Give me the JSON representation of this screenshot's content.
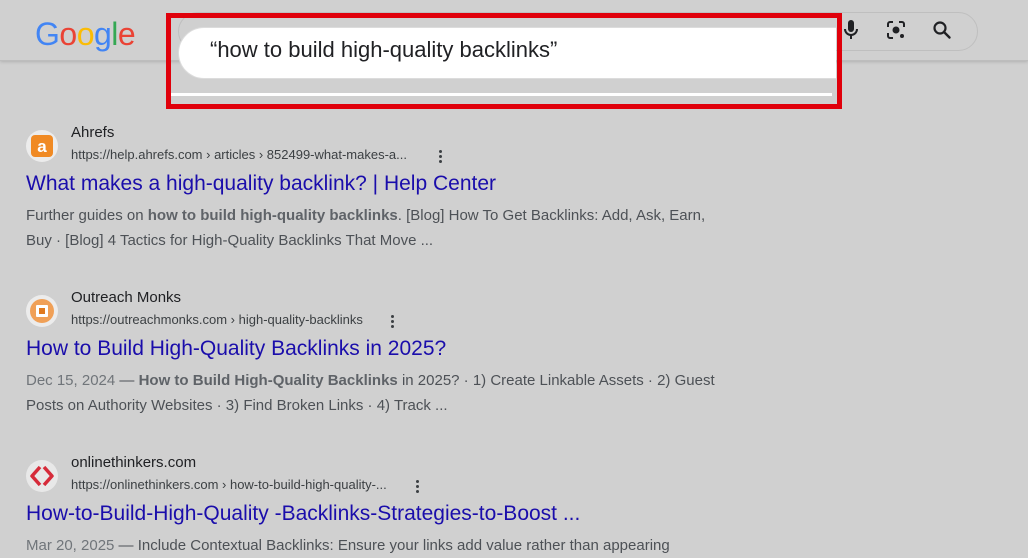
{
  "header": {
    "logo": {
      "letters": [
        "G",
        "o",
        "o",
        "g",
        "l",
        "e"
      ],
      "colors": [
        "#4285f4",
        "#ea4335",
        "#fbbc05",
        "#4285f4",
        "#34a853",
        "#ea4335"
      ]
    },
    "search": {
      "query": "“how to build high-quality backlinks”"
    },
    "tools": [
      "mic-icon",
      "lens-icon",
      "search-icon"
    ],
    "highlight_color": "#e0000b"
  },
  "results": [
    {
      "site_name": "Ahrefs",
      "url": "https://help.ahrefs.com › articles › 852499-what-makes-a...",
      "favicon": "ahrefs-icon",
      "title": "What makes a high-quality backlink? | Help Center",
      "snippet_lines": [
        {
          "pre": "Further guides on ",
          "bold": "how to build high-quality backlinks",
          "post": ". [Blog] How To Get Backlinks: Add, Ask, Earn,"
        },
        {
          "pre": "Buy · [Blog] 4 Tactics for High-Quality Backlinks That Move ...",
          "bold": "",
          "post": ""
        }
      ]
    },
    {
      "site_name": "Outreach Monks",
      "url": "https://outreachmonks.com › high-quality-backlinks",
      "favicon": "outreach-monks-icon",
      "title": "How to Build High-Quality Backlinks in 2025?",
      "snippet_lines": [
        {
          "date": "Dec 15, 2024",
          "pre": " — ",
          "bold": "How to Build High-Quality Backlinks",
          "post": " in 2025? · 1) Create Linkable Assets · 2) Guest"
        },
        {
          "pre": "Posts on Authority Websites · 3) Find Broken Links · 4) Track ...",
          "bold": "",
          "post": ""
        }
      ]
    },
    {
      "site_name": "onlinethinkers.com",
      "url": "https://onlinethinkers.com › how-to-build-high-quality-...",
      "favicon": "onlinethinkers-icon",
      "title": "How-to-Build-High-Quality -Backlinks-Strategies-to-Boost ...",
      "snippet_lines": [
        {
          "date": "Mar 20, 2025",
          "pre": " — Include Contextual Backlinks: Ensure your links add value rather than appearing",
          "bold": "",
          "post": ""
        }
      ]
    }
  ],
  "colors": {
    "link": "#1a0dab",
    "background": "#d0d0d0"
  }
}
